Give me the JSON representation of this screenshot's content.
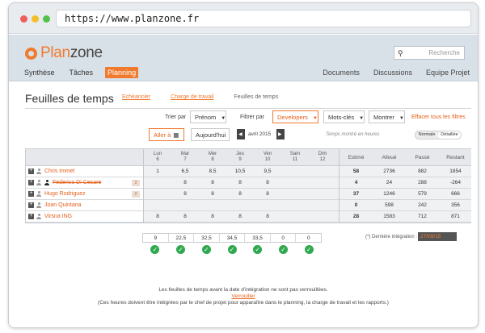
{
  "browser": {
    "url": "https://www.planzone.fr",
    "dots": [
      "#ee5f5b",
      "#f3be2a",
      "#53c24a"
    ]
  },
  "app": {
    "logo_plan": "Plan",
    "logo_zone": "zone",
    "search_placeholder": "Recherche",
    "nav_left": [
      "Synthèse",
      "Tâches",
      "Planning"
    ],
    "nav_active": "Planning",
    "nav_right": [
      "Documents",
      "Discussions",
      "Equipe Projet"
    ],
    "accent": "#f07a2e"
  },
  "page": {
    "title": "Feuilles de temps",
    "subtabs": [
      "Echéancier",
      "Charge de travail",
      "Feuilles de temps"
    ],
    "sort_label": "Trier par",
    "sort_value": "Prénom",
    "filter_label": "Filtrer par",
    "filter_value": "Developers",
    "keywords": "Mots-clés",
    "show": "Montrer",
    "clear_filters": "Effacer tous les filtres",
    "goto": "Aller à",
    "today": "Aujourd'hui",
    "period": "avril 2015",
    "hint": "Temps montré en heures",
    "view_normal": "Normale",
    "view_detail": "Détaillée"
  },
  "grid": {
    "days": [
      {
        "name": "Lun",
        "num": "6"
      },
      {
        "name": "Mar",
        "num": "7"
      },
      {
        "name": "Mer",
        "num": "8"
      },
      {
        "name": "Jeu",
        "num": "9"
      },
      {
        "name": "Ven",
        "num": "10"
      },
      {
        "name": "Sam",
        "num": "11"
      },
      {
        "name": "Dim",
        "num": "12"
      }
    ],
    "total_headers": [
      "Estimé",
      "Alloué",
      "Passé",
      "Restant"
    ],
    "rows": [
      {
        "name": "Chris Immel",
        "days": [
          "1",
          "6,5",
          "8,5",
          "10,5",
          "9,5",
          "",
          ""
        ],
        "totals": [
          "58",
          "2736",
          "882",
          "1854"
        ]
      },
      {
        "name": "Federico Di Cesare",
        "days": [
          "",
          "8",
          "8",
          "8",
          "8",
          "",
          ""
        ],
        "totals": [
          "4",
          "24",
          "288",
          "-264"
        ],
        "badge": "2"
      },
      {
        "name": "Hugo Rodriguez",
        "days": [
          "",
          "8",
          "8",
          "8",
          "8",
          "",
          ""
        ],
        "totals": [
          "37",
          "1246",
          "579",
          "666"
        ],
        "badge": "2"
      },
      {
        "name": "Joan Quintana",
        "days": [
          "",
          "",
          "",
          "",
          "",
          "",
          ""
        ],
        "totals": [
          "0",
          "598",
          "242",
          "356"
        ]
      },
      {
        "name": "Virsna ING",
        "days": [
          "8",
          "8",
          "8",
          "8",
          "8",
          "",
          ""
        ],
        "totals": [
          "28",
          "1583",
          "712",
          "871"
        ]
      }
    ],
    "sums": [
      "9",
      "22,5",
      "32,5",
      "34,5",
      "33,5",
      "0",
      "0"
    ]
  },
  "integration": {
    "label": "(*) Dernière intégration :",
    "date": "27/09/15"
  },
  "footnote": {
    "line1": "Les feuilles de temps avant la date d'intégration ne sont pas verrouillées.",
    "link": "Verrouiller",
    "line3": "(Ces heures doivent être intégrées par le chef de projet pour apparaître dans le planning, la charge de travail et les rapports.)"
  }
}
